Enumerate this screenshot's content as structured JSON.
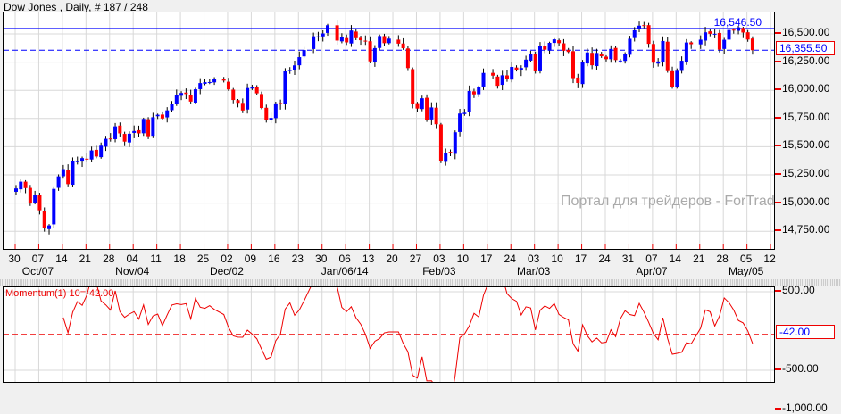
{
  "title": "Dow Jones , Daily, # 187 / 248",
  "watermark": "Портал для трейдеров - ForTrader",
  "top_line_label": "16,546.50",
  "colors": {
    "up": "#0000ff",
    "down": "#ff0000",
    "grid": "#d8d8d8"
  },
  "chart_data": [
    {
      "type": "candlestick",
      "title": "Dow Jones , Daily",
      "y_ticks": [
        "16,500.00",
        "16,250.00",
        "16,000.00",
        "15,750.00",
        "15,500.00",
        "15,250.00",
        "15,000.00",
        "14,750.00"
      ],
      "y_tick_values": [
        16500,
        16250,
        16000,
        15750,
        15500,
        15250,
        15000,
        14750
      ],
      "x_ticks": [
        "30",
        "07",
        "14",
        "21",
        "28",
        "04",
        "11",
        "18",
        "25",
        "02",
        "09",
        "16",
        "23",
        "30",
        "06",
        "13",
        "20",
        "27",
        "03",
        "10",
        "17",
        "24",
        "03",
        "10",
        "17",
        "24",
        "31",
        "07",
        "14",
        "21",
        "28",
        "05",
        "12"
      ],
      "month_labels": [
        {
          "text": "Oct/07",
          "tick": 1
        },
        {
          "text": "Nov/04",
          "tick": 5
        },
        {
          "text": "Dec/02",
          "tick": 9
        },
        {
          "text": "Jan/06/14",
          "tick": 14
        },
        {
          "text": "Feb/03",
          "tick": 18
        },
        {
          "text": "Mar/03",
          "tick": 22
        },
        {
          "text": "Apr/07",
          "tick": 27
        },
        {
          "text": "May/05",
          "tick": 31
        }
      ],
      "resistance": 16546.5,
      "last_price": 16355.5,
      "last_price_label": "16,355.50",
      "closes": [
        15130,
        15190,
        15133,
        14996,
        15072,
        14936,
        14776,
        14802,
        15126,
        15237,
        15301,
        15168,
        15373,
        15371,
        15399,
        15392,
        15467,
        15413,
        15509,
        15570,
        15568,
        15680,
        15618,
        15545,
        15615,
        15639,
        15618,
        15746,
        15593,
        15761,
        15783,
        15750,
        15822,
        15876,
        15961,
        15976,
        15967,
        15900,
        16009,
        16064,
        16072,
        16073,
        16097,
        16086,
        16008,
        15914,
        15889,
        15821,
        16020,
        16025,
        15973,
        15843,
        15739,
        15755,
        15884,
        15875,
        16168,
        16179,
        16221,
        16294,
        16357,
        16479,
        16478,
        16504,
        16577,
        16441,
        16469,
        16425,
        16530,
        16462,
        16444,
        16437,
        16257,
        16374,
        16481,
        16418,
        16458,
        16414,
        16373,
        16197,
        15879,
        15838,
        15929,
        15739,
        15848,
        15699,
        15373,
        15445,
        15440,
        15628,
        15794,
        15801,
        15994,
        15964,
        16027,
        16154,
        16130,
        16040,
        16133,
        16103,
        16207,
        16179,
        16198,
        16272,
        16321,
        16168,
        16395,
        16360,
        16421,
        16452,
        16418,
        16351,
        16340,
        16108,
        16065,
        16247,
        16336,
        16222,
        16331,
        16302,
        16276,
        16367,
        16268,
        16264,
        16323,
        16457,
        16532,
        16573,
        16572,
        16412,
        16245,
        16256,
        16437,
        16170,
        16027,
        16173,
        16262,
        16424,
        16409,
        16449,
        16514,
        16501,
        16501,
        16361,
        16448,
        16535,
        16530,
        16558,
        16512,
        16450,
        16355.5
      ]
    },
    {
      "type": "line",
      "title": "Momentum(1) 10=-42.00",
      "period": 10,
      "y_ticks": [
        "500.00",
        "-500.00",
        "-1,000.00"
      ],
      "y_tick_values": [
        500,
        -500,
        -1000
      ],
      "last_value": -42,
      "last_value_label": "-42.00"
    }
  ]
}
